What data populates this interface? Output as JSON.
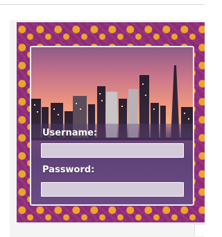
{
  "login": {
    "username_label": "Username:",
    "username_value": "",
    "password_label": "Password:",
    "password_value": ""
  },
  "colors": {
    "frame_background": "#8e2a78",
    "frame_pattern": "#f2aa28",
    "field_background": "#ffffff"
  }
}
